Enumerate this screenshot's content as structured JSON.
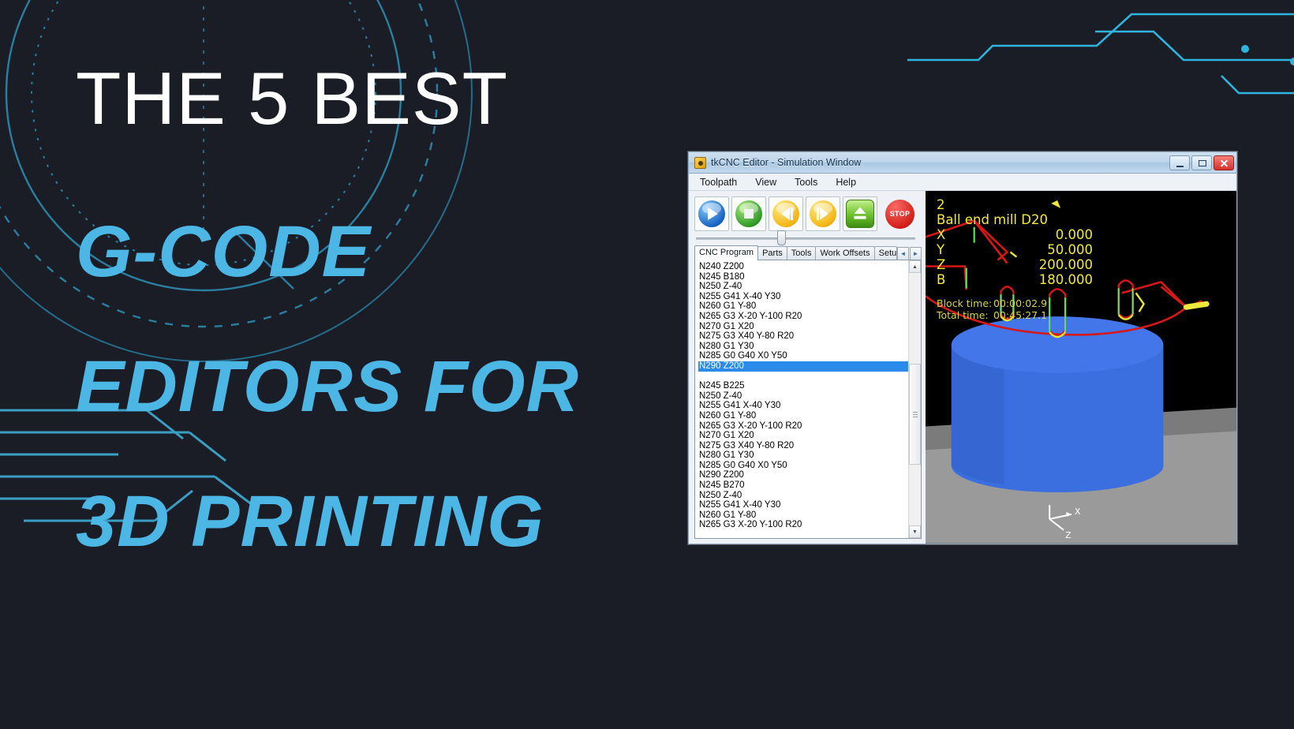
{
  "banner": {
    "line1": "THE 5 BEST",
    "line2": "G-CODE",
    "line3": "EDITORS FOR",
    "line4": "3D PRINTING",
    "white": "#ffffff",
    "accent": "#4cb6e5",
    "background": "#1b1d26"
  },
  "window": {
    "title": "tkCNC Editor - Simulation Window",
    "buttons": {
      "minimize": "minimize",
      "maximize": "maximize",
      "close": "close"
    },
    "menu": [
      "Toolpath",
      "View",
      "Tools",
      "Help"
    ],
    "toolbar": [
      {
        "name": "play-button",
        "icon": "play-orb"
      },
      {
        "name": "stop-playback-button",
        "icon": "square-orb"
      },
      {
        "name": "step-back-button",
        "icon": "step-back-orb"
      },
      {
        "name": "step-forward-button",
        "icon": "step-forward-orb"
      },
      {
        "name": "eject-button",
        "icon": "eject-square"
      },
      {
        "name": "emergency-stop-button",
        "icon": "stop-sign",
        "label": "STOP"
      }
    ],
    "tabs": [
      {
        "label": "CNC Program",
        "active": true
      },
      {
        "label": "Parts",
        "active": false
      },
      {
        "label": "Tools",
        "active": false
      },
      {
        "label": "Work Offsets",
        "active": false
      },
      {
        "label": "Setup",
        "active": false
      }
    ],
    "tab_scroll": {
      "left": "◄",
      "right": "►"
    },
    "code_lines": [
      {
        "text": "N240 Z200",
        "selected": false
      },
      {
        "text": "N245 B180",
        "selected": false
      },
      {
        "text": "N250 Z-40",
        "selected": false
      },
      {
        "text": "N255 G41 X-40 Y30",
        "selected": false
      },
      {
        "text": "N260 G1 Y-80",
        "selected": false
      },
      {
        "text": "N265 G3 X-20 Y-100 R20",
        "selected": false
      },
      {
        "text": "N270 G1 X20",
        "selected": false
      },
      {
        "text": "N275 G3 X40 Y-80 R20",
        "selected": false
      },
      {
        "text": "N280 G1 Y30",
        "selected": false
      },
      {
        "text": "N285 G0 G40 X0 Y50",
        "selected": false
      },
      {
        "text": "N290 Z200",
        "selected": true
      },
      {
        "text": "",
        "selected": false
      },
      {
        "text": "N245 B225",
        "selected": false
      },
      {
        "text": "N250 Z-40",
        "selected": false
      },
      {
        "text": "N255 G41 X-40 Y30",
        "selected": false
      },
      {
        "text": "N260 G1 Y-80",
        "selected": false
      },
      {
        "text": "N265 G3 X-20 Y-100 R20",
        "selected": false
      },
      {
        "text": "N270 G1 X20",
        "selected": false
      },
      {
        "text": "N275 G3 X40 Y-80 R20",
        "selected": false
      },
      {
        "text": "N280 G1 Y30",
        "selected": false
      },
      {
        "text": "N285 G0 G40 X0 Y50",
        "selected": false
      },
      {
        "text": "N290 Z200",
        "selected": false
      },
      {
        "text": "N245 B270",
        "selected": false
      },
      {
        "text": "N250 Z-40",
        "selected": false
      },
      {
        "text": "N255 G41 X-40 Y30",
        "selected": false
      },
      {
        "text": "N260 G1 Y-80",
        "selected": false
      },
      {
        "text": "N265 G3 X-20 Y-100 R20",
        "selected": false
      }
    ],
    "selection_color": "#2a8bea",
    "dro": {
      "tool_number": "2",
      "tool_name": "Ball end mill D20",
      "axes": [
        {
          "axis": "X",
          "value": "0.000"
        },
        {
          "axis": "Y",
          "value": "50.000"
        },
        {
          "axis": "Z",
          "value": "200.000"
        },
        {
          "axis": "B",
          "value": "180.000"
        }
      ],
      "block_time_label": "Block time:",
      "block_time": "00:00:02.9",
      "total_time_label": "Total time:",
      "total_time": "00:45:27.1",
      "text_color": "#f2e93c"
    },
    "viewport": {
      "axis_x_label": "X",
      "axis_z_label": "Z",
      "stock_color": "#3b6fe0",
      "toolpath_color": "#d81717"
    }
  }
}
